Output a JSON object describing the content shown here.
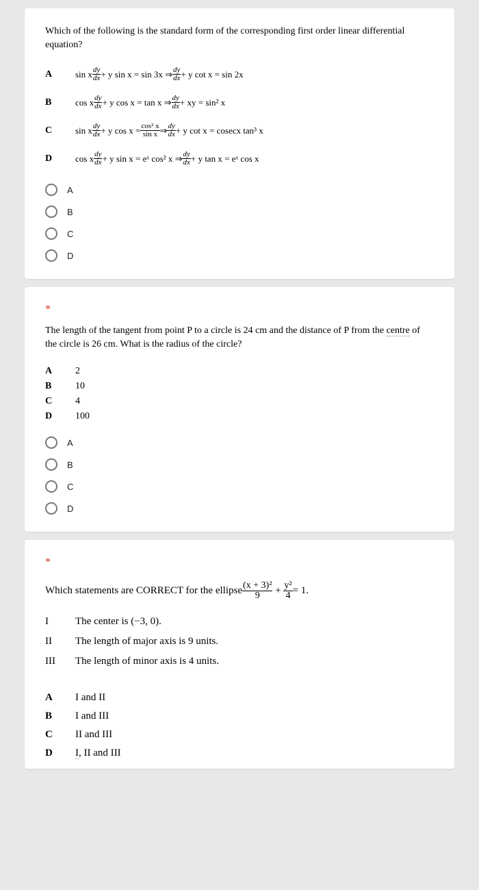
{
  "q1": {
    "question": "Which of the following is the standard form of the corresponding first order linear differential equation?",
    "choices": {
      "A": {
        "lhs_coef": "sin x",
        "rhs1": "+ y sin x = sin 3x ⇒",
        "rhs_coef": "",
        "rhs2": "+ y cot x = sin 2x"
      },
      "B": {
        "lhs_coef": "cos x",
        "rhs1": "+ y cos x = tan x ⇒",
        "rhs_coef": "",
        "rhs2": "+ xy = sin² x"
      },
      "C": {
        "lhs_coef": "sin x",
        "rhs1": "+ y cos x = ",
        "mid_top": "cos² x",
        "mid_bot": "sin x",
        "rhs_arrow": " ⇒ ",
        "rhs2": "+ y cot x = cosecx tan³ x"
      },
      "D": {
        "lhs_coef": "cos x",
        "rhs1": "+ y sin x = eˣ cos² x ⇒",
        "rhs_coef": "",
        "rhs2": "+ y tan x = eˣ cos x"
      }
    },
    "radios": [
      "A",
      "B",
      "C",
      "D"
    ]
  },
  "q2": {
    "required": "*",
    "question_pre": "The length of the tangent from point  P to a circle is 24 cm and the distance of  P from the ",
    "question_span": "centre",
    "question_post": " of the circle is 26 cm. What is the radius of the circle?",
    "choices": {
      "A": "2",
      "B": "10",
      "C": "4",
      "D": "100"
    },
    "radios": [
      "A",
      "B",
      "C",
      "D"
    ]
  },
  "q3": {
    "required": "*",
    "question": "Which statements are CORRECT for the ellipse ",
    "eq_n1": "(x + 3)²",
    "eq_d1": "9",
    "eq_n2": "y²",
    "eq_d2": "4",
    "eq_tail": " = 1.",
    "statements": {
      "I": "The center is (−3, 0).",
      "II": "The length of major axis is 9 units.",
      "III": "The length of minor axis is 4 units."
    },
    "answers": {
      "A": "I and II",
      "B": "I and III",
      "C": "II and III",
      "D_pre": "I",
      "D_post": " II and III"
    }
  }
}
